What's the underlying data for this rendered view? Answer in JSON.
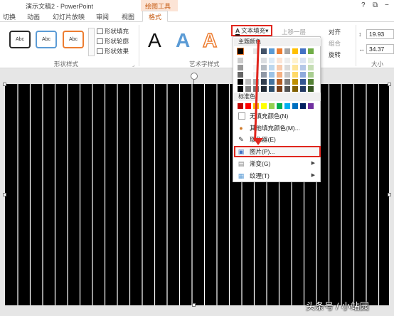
{
  "titlebar": {
    "doc_title": "演示文稿2 - PowerPoint",
    "context_group": "绘图工具",
    "help": "?",
    "restore": "⧉",
    "minimize": "−"
  },
  "tabs": [
    "切换",
    "动画",
    "幻灯片放映",
    "审阅",
    "视图",
    "格式"
  ],
  "ribbon": {
    "shape_styles": {
      "sample_text": "Abc",
      "fill": "形状填充",
      "outline": "形状轮廓",
      "effects": "形状效果",
      "label": "形状样式",
      "launcher": "⌟"
    },
    "wordart": {
      "letter": "A",
      "label": "艺术字样式"
    },
    "text_fill": {
      "icon_letter": "A",
      "label": "文本填充",
      "caret": "▾"
    },
    "arrange": {
      "bring_forward": "上移一层",
      "align": "对齐",
      "group": "组合",
      "rotate": "旋转"
    },
    "size": {
      "height": "19.93",
      "width": "34.37",
      "label": "大小"
    }
  },
  "menu": {
    "theme_colors_header": "主题颜色",
    "standard_colors_header": "标准色",
    "no_fill": "无填充颜色(N)",
    "more_colors": "其他填充颜色(M)...",
    "eyedropper": "取色器(E)",
    "picture": "图片(P)...",
    "gradient": "渐变(G)",
    "texture": "纹理(T)",
    "submenu_arrow": "▶"
  },
  "colors": {
    "theme_top": [
      "#000000",
      "#ffffff",
      "#e7e6e6",
      "#44546a",
      "#5b9bd5",
      "#ed7d31",
      "#a5a5a5",
      "#ffc000",
      "#4472c4",
      "#70ad47"
    ],
    "standard": [
      "#c00000",
      "#ff0000",
      "#ffc000",
      "#ffff00",
      "#92d050",
      "#00b050",
      "#00b0f0",
      "#0070c0",
      "#002060",
      "#7030a0"
    ],
    "highlight": "#e0261e"
  },
  "watermark": "头条号 / 小站园"
}
